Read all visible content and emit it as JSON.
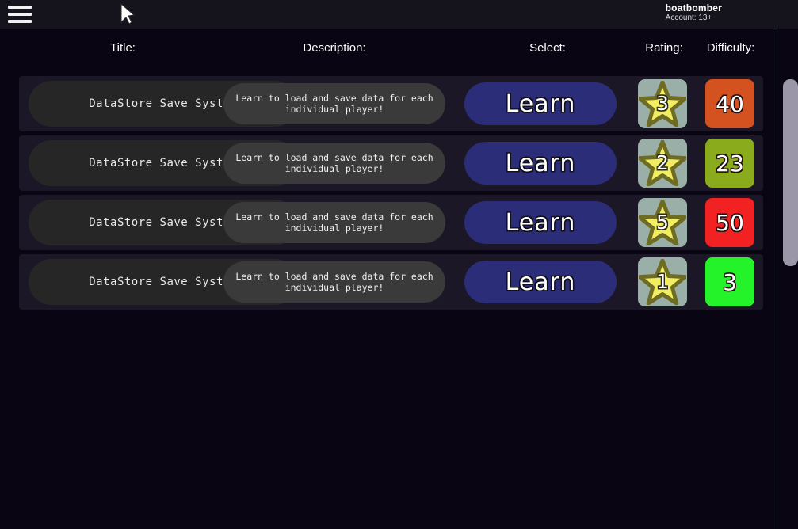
{
  "topbar": {
    "menu_icon": "hamburger-menu-icon",
    "cursor_icon": "mouse-pointer-icon",
    "account": {
      "username": "boatbomber",
      "account_type": "Account: 13+"
    }
  },
  "headers": {
    "title": "Title:",
    "description": "Description:",
    "select": "Select:",
    "rating": "Rating:",
    "difficulty": "Difficulty:"
  },
  "colors": {
    "page_background": "#0a0513",
    "topbar_background": "#15131c",
    "row_background": "#1b1726",
    "title_pill": "#262626",
    "description_pill": "#3a3a3a",
    "learn_button": "#2c2d78",
    "rating_badge": "#9aafa8",
    "star_fill": "#f2ee63",
    "star_outline": "#6e6b22",
    "scrollbar_thumb": "#9a98a8"
  },
  "rows": [
    {
      "title": "DataStore Save System",
      "description": "Learn to load and save data for each individual player!",
      "select_label": "Learn",
      "rating": "3",
      "difficulty": "40",
      "difficulty_color": "#d4521f"
    },
    {
      "title": "DataStore Save System",
      "description": "Learn to load and save data for each individual player!",
      "select_label": "Learn",
      "rating": "2",
      "difficulty": "23",
      "difficulty_color": "#8aab1b"
    },
    {
      "title": "DataStore Save System",
      "description": "Learn to load and save data for each individual player!",
      "select_label": "Learn",
      "rating": "5",
      "difficulty": "50",
      "difficulty_color": "#f32222"
    },
    {
      "title": "DataStore Save System",
      "description": "Learn to load and save data for each individual player!",
      "select_label": "Learn",
      "rating": "1",
      "difficulty": "3",
      "difficulty_color": "#25f32a"
    }
  ]
}
